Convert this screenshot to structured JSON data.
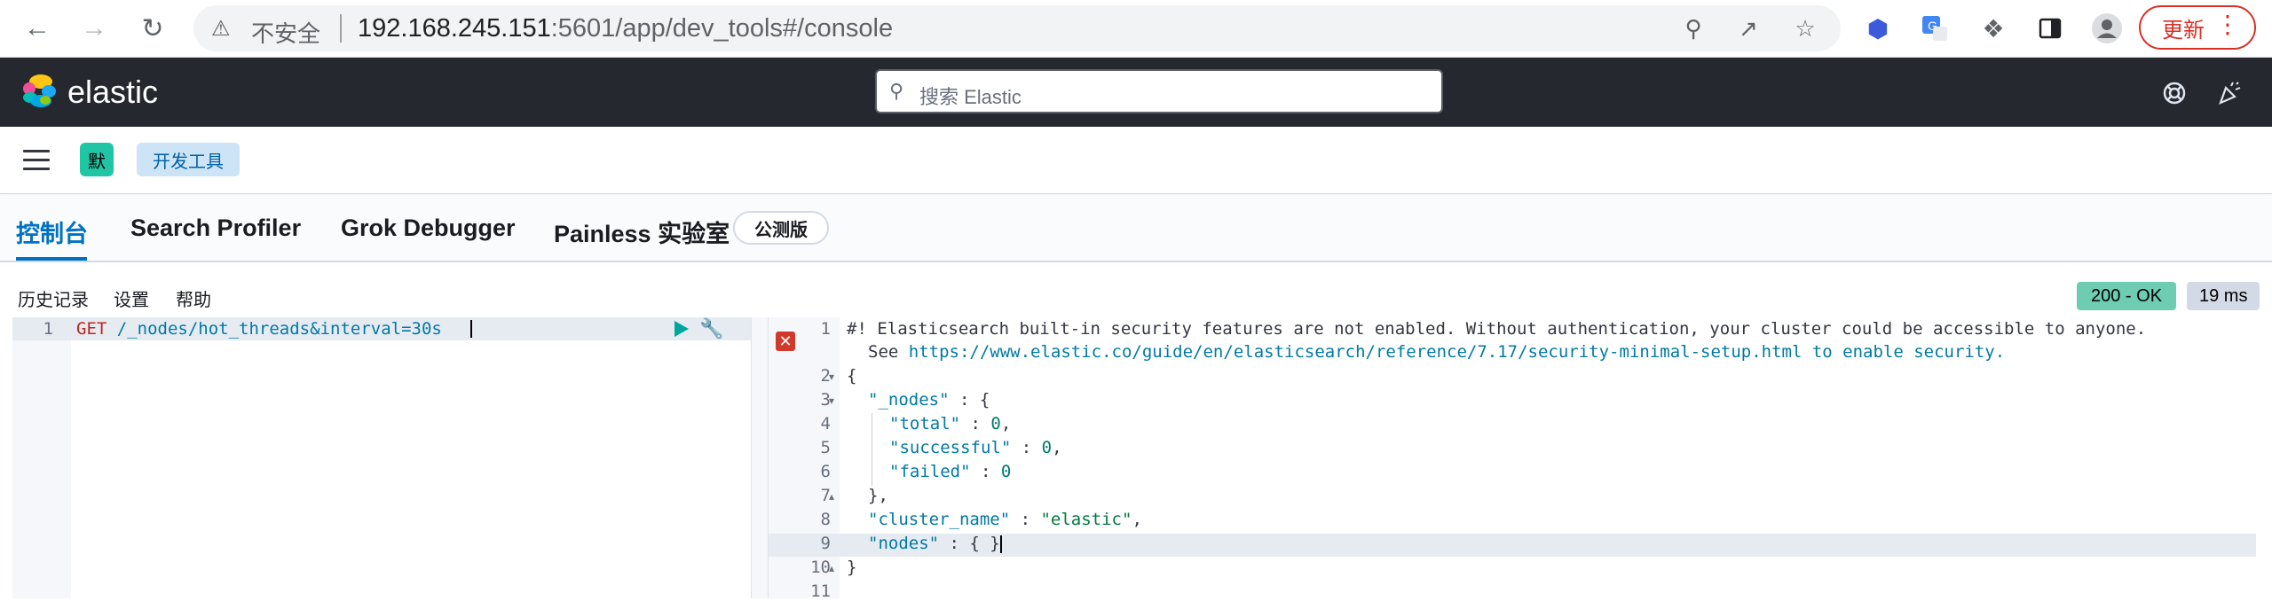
{
  "browser": {
    "back_icon": "arrow-left-icon",
    "forward_icon": "arrow-right-icon",
    "reload_icon": "reload-icon",
    "insecure_label": "不安全",
    "url_host": "192.168.245.151",
    "url_rest": ":5601/app/dev_tools#/console",
    "update_label": "更新"
  },
  "elastic": {
    "logo_text": "elastic",
    "search_placeholder": "搜索 Elastic"
  },
  "breadcrumb": {
    "space_initial": "默",
    "current": "开发工具"
  },
  "tabs": [
    {
      "label": "控制台",
      "active": true
    },
    {
      "label": "Search Profiler",
      "active": false
    },
    {
      "label": "Grok Debugger",
      "active": false
    },
    {
      "label": "Painless 实验室",
      "active": false
    }
  ],
  "beta_badge": "公测版",
  "toolbar": {
    "history": "历史记录",
    "settings": "设置",
    "help": "帮助",
    "status": "200 - OK",
    "duration": "19 ms"
  },
  "request_editor": {
    "line_numbers": [
      "1"
    ],
    "method": "GET",
    "path": "/_nodes/hot_threads&interval=30s"
  },
  "response_editor": {
    "line_numbers": [
      "1",
      "",
      "2",
      "3",
      "4",
      "5",
      "6",
      "7",
      "8",
      "9",
      "10",
      "11"
    ],
    "comment_line1": "#! Elasticsearch built-in security features are not enabled. Without authentication, your cluster could be accessible to anyone.",
    "comment_line2_prefix": "See ",
    "comment_line2_url": "https://www.elastic.co/guide/en/elasticsearch/reference/7.17/security-minimal-setup.html",
    "comment_line2_suffix": " to enable security.",
    "line2": "{",
    "line3_key": "\"_nodes\"",
    "line3_rest": " : {",
    "line4_key": "\"total\"",
    "line4_val": "0",
    "line5_key": "\"successful\"",
    "line5_val": "0",
    "line6_key": "\"failed\"",
    "line6_val": "0",
    "line7": "},",
    "line8_key": "\"cluster_name\"",
    "line8_val": "\"elastic\"",
    "line9_key": "\"nodes\"",
    "line9_rest": " : { }",
    "line10": "}"
  }
}
